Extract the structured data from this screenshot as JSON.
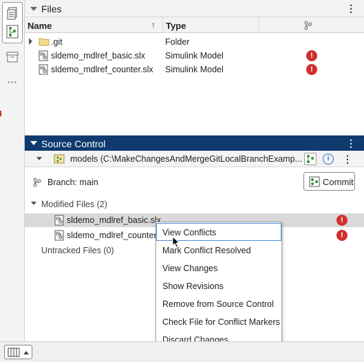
{
  "files_panel": {
    "title": "Files",
    "columns": {
      "name": "Name",
      "type": "Type"
    },
    "rows": [
      {
        "name": ".git",
        "type": "Folder",
        "kind": "folder",
        "status": ""
      },
      {
        "name": "sldemo_mdlref_basic.slx",
        "type": "Simulink Model",
        "kind": "model",
        "status": "!"
      },
      {
        "name": "sldemo_mdlref_counter.slx",
        "type": "Simulink Model",
        "kind": "model",
        "status": "!"
      }
    ]
  },
  "source_control": {
    "title": "Source Control",
    "repo": "models (C:\\MakeChangesAndMergeGitLocalBranchExamp...",
    "branch": "Branch: main",
    "commit_label": "Commit",
    "modified_header": "Modified Files (2)",
    "modified_files": [
      {
        "name": "sldemo_mdlref_basic.slx",
        "status": "!"
      },
      {
        "name": "sldemo_mdlref_counter.s",
        "status": "!"
      }
    ],
    "untracked_header": "Untracked Files (0)"
  },
  "context_menu": {
    "items": [
      "View Conflicts",
      "Mark Conflict Resolved",
      "View Changes",
      "Show Revisions",
      "Remove from Source Control",
      "Check File for Conflict Markers",
      "Discard Changes"
    ]
  },
  "colors": {
    "panel_header_active": "#0e3a6e",
    "error": "#d12f2f",
    "selection": "#d9d9d9",
    "menu_highlight_border": "#4a8fd6"
  },
  "icons": {
    "left_strip": [
      "files-panel-icon",
      "source-control-panel-icon",
      "archive-icon",
      "more-icon"
    ],
    "bottom": "layout-columns-icon"
  }
}
